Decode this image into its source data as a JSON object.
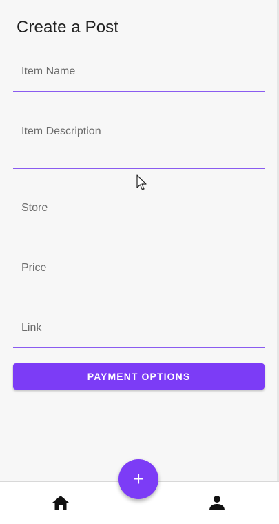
{
  "page": {
    "title": "Create a Post"
  },
  "form": {
    "fields": [
      {
        "placeholder": "Item Name",
        "value": ""
      },
      {
        "placeholder": "Item Description",
        "value": ""
      },
      {
        "placeholder": "Store",
        "value": ""
      },
      {
        "placeholder": "Price",
        "value": ""
      },
      {
        "placeholder": "Link",
        "value": ""
      }
    ],
    "payment_button_label": "PAYMENT OPTIONS"
  },
  "fab": {
    "label": "+",
    "icon": "plus-icon"
  },
  "bottom_nav": {
    "items": [
      {
        "icon": "home-icon"
      },
      {
        "icon": "person-icon"
      }
    ]
  },
  "colors": {
    "accent": "#7c3cf6",
    "underline": "#8a5cf0",
    "background": "#f7f7f7"
  }
}
